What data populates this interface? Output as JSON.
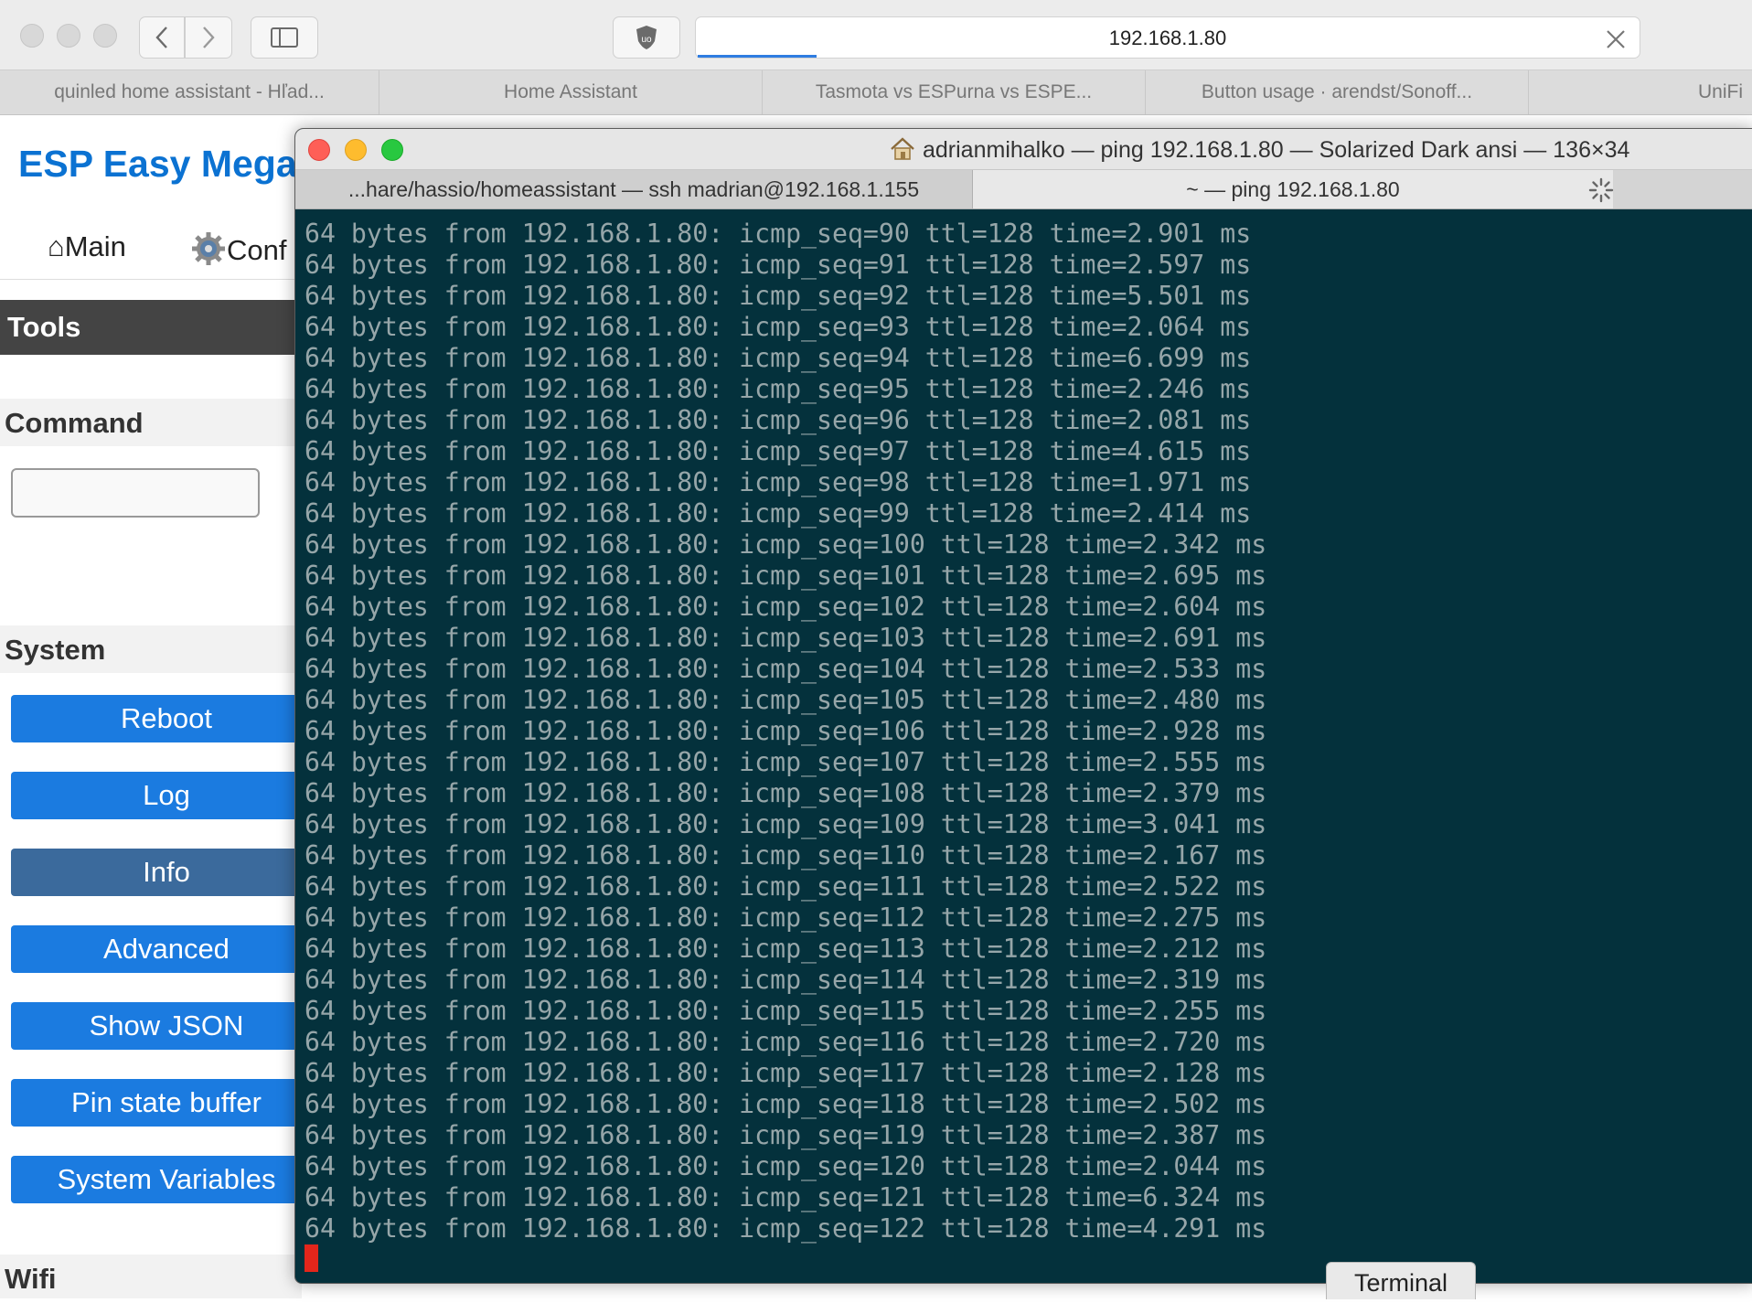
{
  "browser": {
    "url": "192.168.1.80",
    "tabs": [
      {
        "label": "quinled home assistant - Hľad..."
      },
      {
        "label": "Home Assistant"
      },
      {
        "label": "Tasmota vs ESPurna vs ESPE..."
      },
      {
        "label": "Button usage · arendst/Sonoff..."
      },
      {
        "label": "UniFi"
      }
    ],
    "icons": {
      "back": "chevron-left-icon",
      "forward": "chevron-right-icon",
      "sidebar": "sidebar-icon",
      "shield": "ublock-shield-icon",
      "close": "close-icon"
    }
  },
  "esp": {
    "title": "ESP Easy Mega",
    "nav": {
      "main": "⌂Main",
      "config": "Conf"
    },
    "tools_header": "Tools",
    "command_header": "Command",
    "system_header": "System",
    "wifi_header": "Wifi",
    "buttons": {
      "reboot": "Reboot",
      "log": "Log",
      "info": "Info",
      "advanced": "Advanced",
      "show_json": "Show JSON",
      "pin_state": "Pin state buffer",
      "system_vars": "System Variables"
    },
    "colors": {
      "brand": "#0b72d2",
      "button": "#1b7be0",
      "button_active": "#3b6a9c"
    }
  },
  "terminal": {
    "title": "adrianmihalko — ping 192.168.1.80 — Solarized Dark ansi — 136×34",
    "tabs": [
      {
        "label": "...hare/hassio/homeassistant — ssh madrian@192.168.1.155"
      },
      {
        "label": "~ — ping 192.168.1.80"
      }
    ],
    "lines": [
      "64 bytes from 192.168.1.80: icmp_seq=90 ttl=128 time=2.901 ms",
      "64 bytes from 192.168.1.80: icmp_seq=91 ttl=128 time=2.597 ms",
      "64 bytes from 192.168.1.80: icmp_seq=92 ttl=128 time=5.501 ms",
      "64 bytes from 192.168.1.80: icmp_seq=93 ttl=128 time=2.064 ms",
      "64 bytes from 192.168.1.80: icmp_seq=94 ttl=128 time=6.699 ms",
      "64 bytes from 192.168.1.80: icmp_seq=95 ttl=128 time=2.246 ms",
      "64 bytes from 192.168.1.80: icmp_seq=96 ttl=128 time=2.081 ms",
      "64 bytes from 192.168.1.80: icmp_seq=97 ttl=128 time=4.615 ms",
      "64 bytes from 192.168.1.80: icmp_seq=98 ttl=128 time=1.971 ms",
      "64 bytes from 192.168.1.80: icmp_seq=99 ttl=128 time=2.414 ms",
      "64 bytes from 192.168.1.80: icmp_seq=100 ttl=128 time=2.342 ms",
      "64 bytes from 192.168.1.80: icmp_seq=101 ttl=128 time=2.695 ms",
      "64 bytes from 192.168.1.80: icmp_seq=102 ttl=128 time=2.604 ms",
      "64 bytes from 192.168.1.80: icmp_seq=103 ttl=128 time=2.691 ms",
      "64 bytes from 192.168.1.80: icmp_seq=104 ttl=128 time=2.533 ms",
      "64 bytes from 192.168.1.80: icmp_seq=105 ttl=128 time=2.480 ms",
      "64 bytes from 192.168.1.80: icmp_seq=106 ttl=128 time=2.928 ms",
      "64 bytes from 192.168.1.80: icmp_seq=107 ttl=128 time=2.555 ms",
      "64 bytes from 192.168.1.80: icmp_seq=108 ttl=128 time=2.379 ms",
      "64 bytes from 192.168.1.80: icmp_seq=109 ttl=128 time=3.041 ms",
      "64 bytes from 192.168.1.80: icmp_seq=110 ttl=128 time=2.167 ms",
      "64 bytes from 192.168.1.80: icmp_seq=111 ttl=128 time=2.522 ms",
      "64 bytes from 192.168.1.80: icmp_seq=112 ttl=128 time=2.275 ms",
      "64 bytes from 192.168.1.80: icmp_seq=113 ttl=128 time=2.212 ms",
      "64 bytes from 192.168.1.80: icmp_seq=114 ttl=128 time=2.319 ms",
      "64 bytes from 192.168.1.80: icmp_seq=115 ttl=128 time=2.255 ms",
      "64 bytes from 192.168.1.80: icmp_seq=116 ttl=128 time=2.720 ms",
      "64 bytes from 192.168.1.80: icmp_seq=117 ttl=128 time=2.128 ms",
      "64 bytes from 192.168.1.80: icmp_seq=118 ttl=128 time=2.502 ms",
      "64 bytes from 192.168.1.80: icmp_seq=119 ttl=128 time=2.387 ms",
      "64 bytes from 192.168.1.80: icmp_seq=120 ttl=128 time=2.044 ms",
      "64 bytes from 192.168.1.80: icmp_seq=121 ttl=128 time=6.324 ms",
      "64 bytes from 192.168.1.80: icmp_seq=122 ttl=128 time=4.291 ms"
    ],
    "app_label": "Terminal",
    "colors": {
      "background": "#04313c",
      "text": "#96a6a9",
      "cursor": "#e3261b"
    }
  }
}
